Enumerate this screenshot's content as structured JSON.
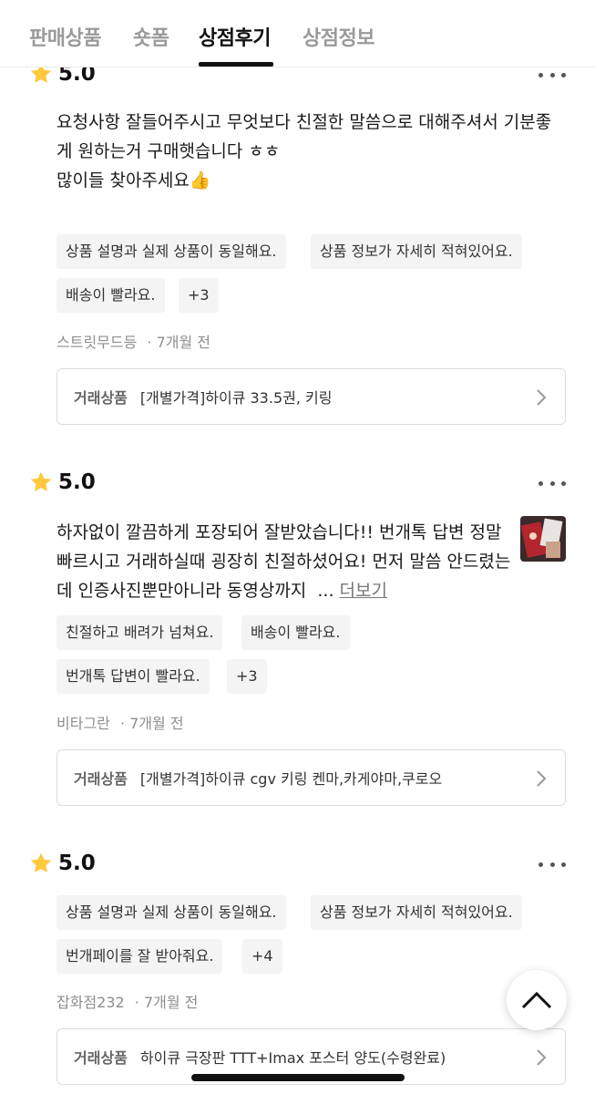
{
  "tabs": [
    {
      "label": "판매상품",
      "active": false
    },
    {
      "label": "숏폼",
      "active": false
    },
    {
      "label": "상점후기",
      "active": true
    },
    {
      "label": "상점정보",
      "active": false
    }
  ],
  "reviews": [
    {
      "rating": "5.0",
      "text": "요청사항 잘들어주시고 무엇보다 친절한 말씀으로 대해주셔서 기분좋게 원하는거 구매햇습니다 ㅎㅎ\n많이들 찾아주세요👍",
      "tags": [
        "상품 설명과 실제 상품이 동일해요.",
        "상품 정보가 자세히 적혀있어요.",
        "배송이 빨라요.",
        "+3"
      ],
      "author": "스트릿무드등",
      "time": "· 7개월 전",
      "product_label": "거래상품",
      "product_name": "[개별가격]하이큐 33.5권, 키링"
    },
    {
      "rating": "5.0",
      "text": "하자없이 깔끔하게 포장되어 잘받았습니다!! 번개톡 답변 정말 빠르시고 거래하실때 굉장히 친절하셨어요! 먼저 말씀 안드렸는데 인증사진뿐만아니라 동영상까지  ...",
      "read_more": "더보기",
      "tags": [
        "친절하고 배려가 넘쳐요.",
        "배송이 빨라요.",
        "번개톡 답변이 빨라요.",
        "+3"
      ],
      "author": "비타그란",
      "time": "· 7개월 전",
      "product_label": "거래상품",
      "product_name": "[개별가격]하이큐 cgv 키링 켄마,카게야마,쿠로오"
    },
    {
      "rating": "5.0",
      "tags": [
        "상품 설명과 실제 상품이 동일해요.",
        "상품 정보가 자세히 적혀있어요.",
        "번개페이를 잘 받아줘요.",
        "+4"
      ],
      "author": "잡화점232",
      "time": "· 7개월 전",
      "product_label": "거래상품",
      "product_name": "하이큐 극장판 TTT+Imax 포스터  양도(수령완료)"
    }
  ],
  "icons": {
    "star": "star-icon",
    "more": "more-dots-icon",
    "chevron": "chevron-right-icon",
    "scroll_top": "chevron-up-icon"
  },
  "colors": {
    "star": "#FFC83D",
    "tag_bg": "#F4F4F4",
    "active_tab": "#111111",
    "inactive_tab": "#9A9A9A"
  }
}
